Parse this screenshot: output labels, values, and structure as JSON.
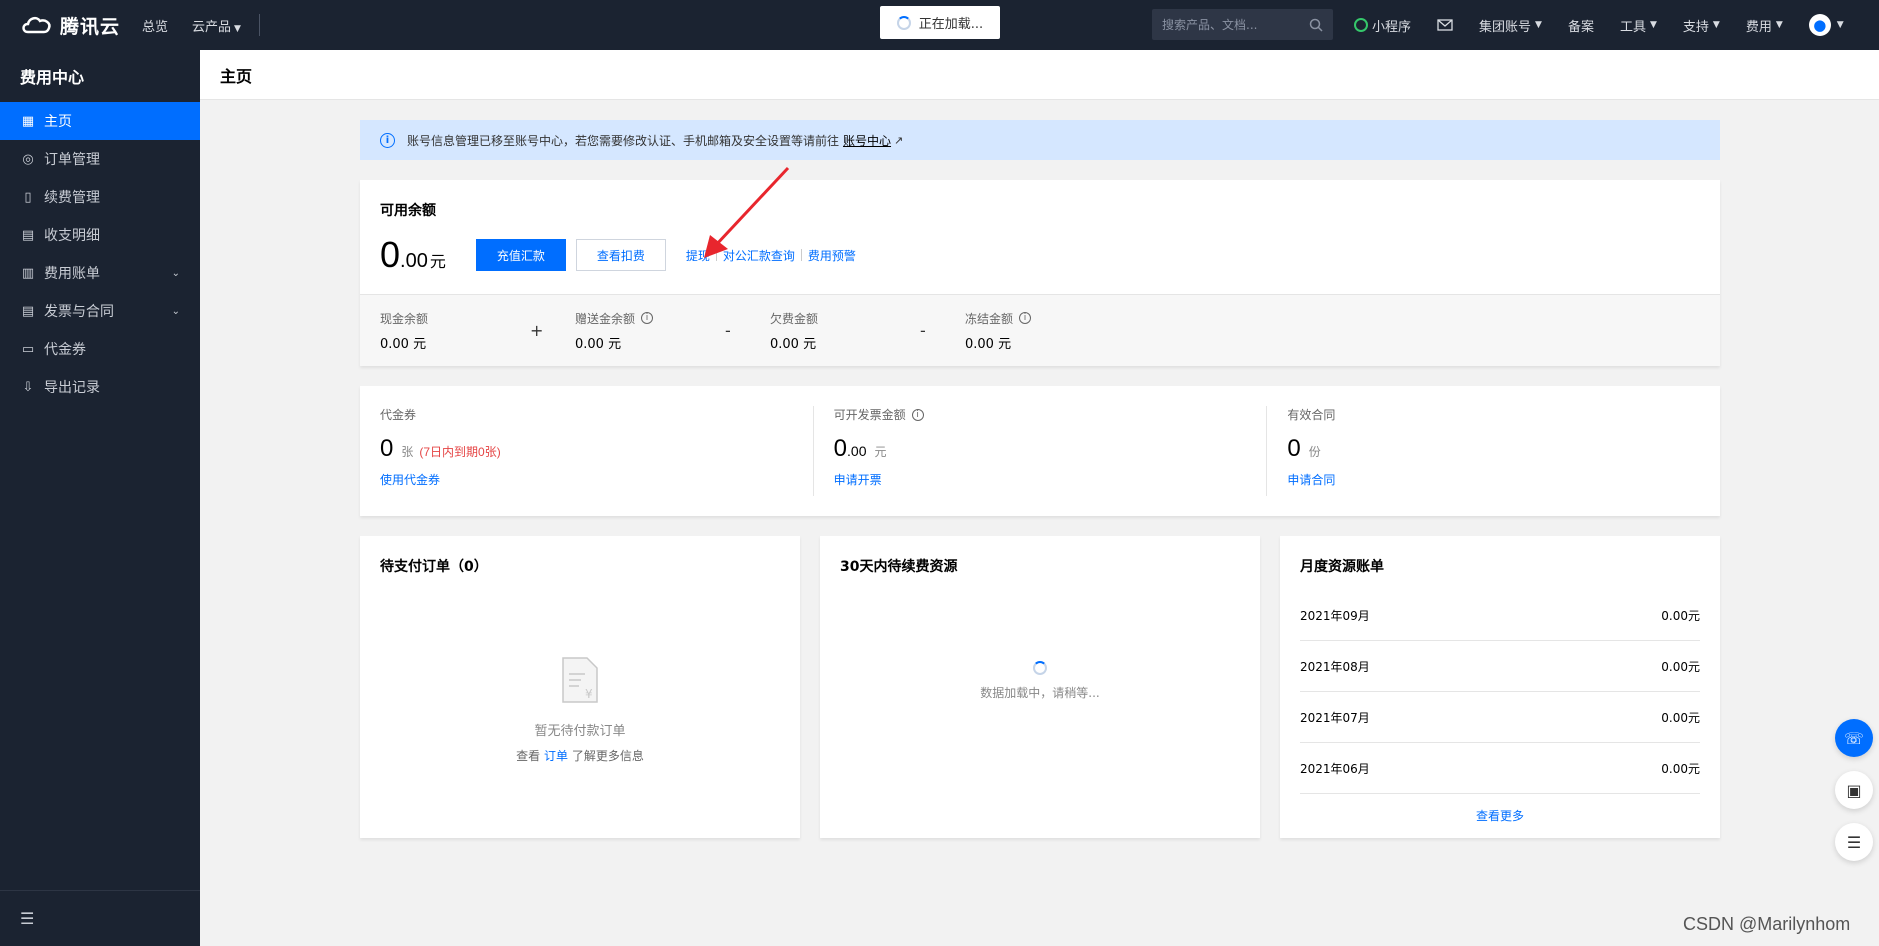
{
  "topbar": {
    "brand": "腾讯云",
    "nav": [
      {
        "label": "总览",
        "dropdown": false
      },
      {
        "label": "云产品",
        "dropdown": true
      }
    ],
    "loading_text": "正在加载...",
    "search_placeholder": "搜索产品、文档...",
    "right_nav": [
      {
        "label": "小程序",
        "icon": "miniprogram-icon"
      },
      {
        "label": "",
        "icon": "mail-icon"
      },
      {
        "label": "集团账号",
        "dropdown": true
      },
      {
        "label": "备案"
      },
      {
        "label": "工具",
        "dropdown": true
      },
      {
        "label": "支持",
        "dropdown": true
      },
      {
        "label": "费用",
        "dropdown": true
      }
    ]
  },
  "sidebar": {
    "title": "费用中心",
    "items": [
      {
        "label": "主页",
        "icon": "grid-icon",
        "active": true
      },
      {
        "label": "订单管理",
        "icon": "coin-icon"
      },
      {
        "label": "续费管理",
        "icon": "renew-icon"
      },
      {
        "label": "收支明细",
        "icon": "detail-icon"
      },
      {
        "label": "费用账单",
        "icon": "bill-icon",
        "expandable": true
      },
      {
        "label": "发票与合同",
        "icon": "invoice-icon",
        "expandable": true
      },
      {
        "label": "代金券",
        "icon": "voucher-icon"
      },
      {
        "label": "导出记录",
        "icon": "export-icon"
      }
    ]
  },
  "page_title": "主页",
  "notice": {
    "text": "账号信息管理已移至账号中心，若您需要修改认证、手机邮箱及安全设置等请前往",
    "link": "账号中心"
  },
  "balance": {
    "title": "可用余额",
    "int": "0",
    "dec": ".00",
    "unit": "元",
    "recharge_btn": "充值汇款",
    "deduct_btn": "查看扣费",
    "links": [
      "提现",
      "对公汇款查询",
      "费用预警"
    ],
    "breakdown": [
      {
        "label": "现金余额",
        "value": "0.00 元"
      },
      {
        "label": "赠送金余额",
        "value": "0.00 元"
      },
      {
        "label": "欠费金额",
        "value": "0.00 元"
      },
      {
        "label": "冻结金额",
        "value": "0.00 元"
      }
    ],
    "ops": [
      "+",
      "-",
      "-"
    ]
  },
  "stats": {
    "voucher": {
      "label": "代金券",
      "num": "0",
      "unit": "张",
      "warn": "(7日内到期0张)",
      "link": "使用代金券"
    },
    "invoice": {
      "label": "可开发票金额",
      "int": "0",
      "dec": ".00",
      "unit": "元",
      "link": "申请开票"
    },
    "contract": {
      "label": "有效合同",
      "num": "0",
      "unit": "份",
      "link": "申请合同"
    }
  },
  "pending_orders": {
    "title": "待支付订单（0）",
    "empty": "暂无待付款订单",
    "sub_before": "查看",
    "sub_link": "订单",
    "sub_after": "了解更多信息"
  },
  "renew": {
    "title": "30天内待续费资源",
    "loading": "数据加载中，请稍等..."
  },
  "monthly": {
    "title": "月度资源账单",
    "rows": [
      {
        "month": "2021年09月",
        "amount": "0.00元"
      },
      {
        "month": "2021年08月",
        "amount": "0.00元"
      },
      {
        "month": "2021年07月",
        "amount": "0.00元"
      },
      {
        "month": "2021年06月",
        "amount": "0.00元"
      }
    ],
    "more": "查看更多"
  },
  "watermark": "CSDN @Marilynhom",
  "colors": {
    "accent": "#006eff",
    "nav_bg": "#1b2331",
    "warn": "#e54545"
  }
}
